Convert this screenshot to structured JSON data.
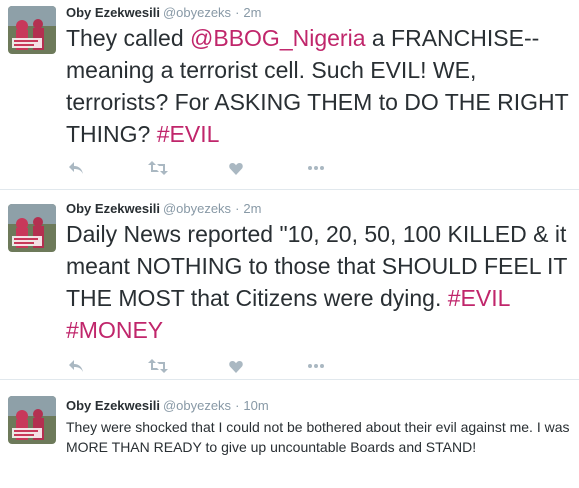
{
  "tweets": [
    {
      "name": "Oby Ezekwesili",
      "handle": "@obyezeks",
      "separator": "·",
      "time": "2m",
      "segments": [
        {
          "text": "They called ",
          "highlight": false
        },
        {
          "text": "@BBOG_Nigeria",
          "highlight": true
        },
        {
          "text": " a FRANCHISE-- meaning a terrorist cell. Such EVIL! WE, terrorists? For ASKING THEM to DO THE RIGHT THING? ",
          "highlight": false
        },
        {
          "text": "#EVIL",
          "highlight": true
        }
      ],
      "size": "big"
    },
    {
      "name": "Oby Ezekwesili",
      "handle": "@obyezeks",
      "separator": "·",
      "time": "2m",
      "segments": [
        {
          "text": "Daily News reported \"10, 20, 50, 100 KILLED & it meant NOTHING to those that SHOULD FEEL IT THE MOST that Citizens were dying. ",
          "highlight": false
        },
        {
          "text": "#EVIL",
          "highlight": true
        },
        {
          "text": " ",
          "highlight": false
        },
        {
          "text": "#MONEY",
          "highlight": true
        }
      ],
      "size": "big"
    },
    {
      "name": "Oby Ezekwesili",
      "handle": "@obyezeks",
      "separator": "·",
      "time": "10m",
      "segments": [
        {
          "text": "They were shocked that I could not be bothered about their evil against me. I was MORE THAN READY to give up uncountable Boards and STAND!",
          "highlight": false
        }
      ],
      "size": "small"
    }
  ],
  "actions": [
    "reply-icon",
    "retweet-icon",
    "like-icon",
    "more-icon"
  ],
  "colors": {
    "hashtag": "#c0266b",
    "muted": "#8899a6",
    "icon": "#aab8c2",
    "text": "#292f33",
    "divider": "#e1e8ed"
  }
}
